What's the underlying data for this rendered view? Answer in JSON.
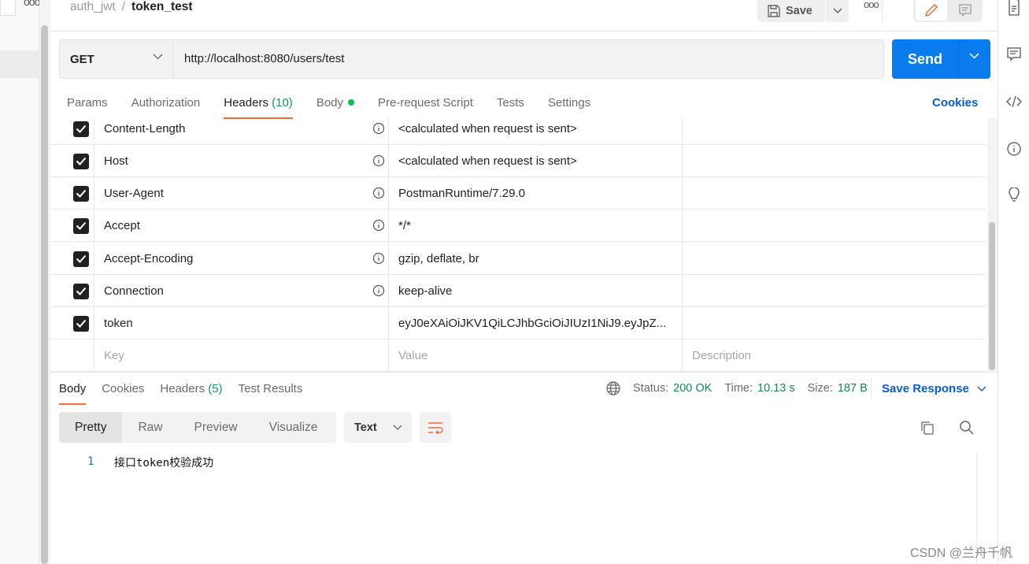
{
  "breadcrumb": {
    "collection": "auth_jwt",
    "separator": "/",
    "request": "token_test"
  },
  "toolbar": {
    "save_label": "Save"
  },
  "request": {
    "method": "GET",
    "url": "http://localhost:8080/users/test",
    "send_label": "Send"
  },
  "request_tabs": [
    {
      "label": "Params"
    },
    {
      "label": "Authorization"
    },
    {
      "label": "Headers",
      "count": "(10)"
    },
    {
      "label": "Body"
    },
    {
      "label": "Pre-request Script"
    },
    {
      "label": "Tests"
    },
    {
      "label": "Settings"
    }
  ],
  "cookies_label": "Cookies",
  "headers": [
    {
      "key": "Content-Length",
      "value": "<calculated when request is sent>",
      "checked": true,
      "info": true
    },
    {
      "key": "Host",
      "value": "<calculated when request is sent>",
      "checked": true,
      "info": true
    },
    {
      "key": "User-Agent",
      "value": "PostmanRuntime/7.29.0",
      "checked": true,
      "info": true
    },
    {
      "key": "Accept",
      "value": "*/*",
      "checked": true,
      "info": true
    },
    {
      "key": "Accept-Encoding",
      "value": "gzip, deflate, br",
      "checked": true,
      "info": true
    },
    {
      "key": "Connection",
      "value": "keep-alive",
      "checked": true,
      "info": true
    },
    {
      "key": "token",
      "value": "eyJ0eXAiOiJKV1QiLCJhbGciOiJIUzI1NiJ9.eyJpZ...",
      "checked": true,
      "info": false
    }
  ],
  "header_placeholders": {
    "key": "Key",
    "value": "Value",
    "description": "Description"
  },
  "response_tabs": [
    {
      "label": "Body"
    },
    {
      "label": "Cookies"
    },
    {
      "label": "Headers",
      "count": "(5)"
    },
    {
      "label": "Test Results"
    }
  ],
  "response_status": {
    "status_label": "Status:",
    "status": "200 OK",
    "time_label": "Time:",
    "time": "10.13 s",
    "size_label": "Size:",
    "size": "187 B",
    "save_response": "Save Response"
  },
  "body_views": [
    {
      "label": "Pretty"
    },
    {
      "label": "Raw"
    },
    {
      "label": "Preview"
    },
    {
      "label": "Visualize"
    }
  ],
  "body_format": "Text",
  "response_body": [
    {
      "line": "1",
      "text": "接口token校验成功"
    }
  ],
  "watermark": "CSDN @兰舟千帆",
  "colors": {
    "accent": "#097bed",
    "active_tab": "#f26b3a",
    "success": "#0d8a53",
    "link": "#0b5cc9"
  }
}
